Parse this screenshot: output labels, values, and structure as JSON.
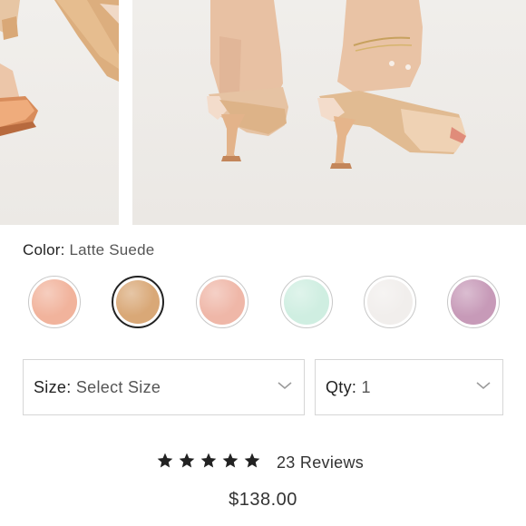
{
  "color": {
    "label": "Color:",
    "value": "Latte Suede"
  },
  "swatches": [
    {
      "name": "Peach",
      "color": "#f1b39c"
    },
    {
      "name": "Latte Suede",
      "color": "#d9a877",
      "selected": true
    },
    {
      "name": "Blush",
      "color": "#efb7a8"
    },
    {
      "name": "Mint",
      "color": "#cfeee1"
    },
    {
      "name": "White",
      "color": "#f1eeec"
    },
    {
      "name": "Lilac",
      "color": "#c79ab8"
    }
  ],
  "size": {
    "label": "Size:",
    "value": "Select Size"
  },
  "qty": {
    "label": "Qty:",
    "value": "1"
  },
  "rating": {
    "stars": 5,
    "reviews_text": "23 Reviews"
  },
  "price": "$138.00"
}
